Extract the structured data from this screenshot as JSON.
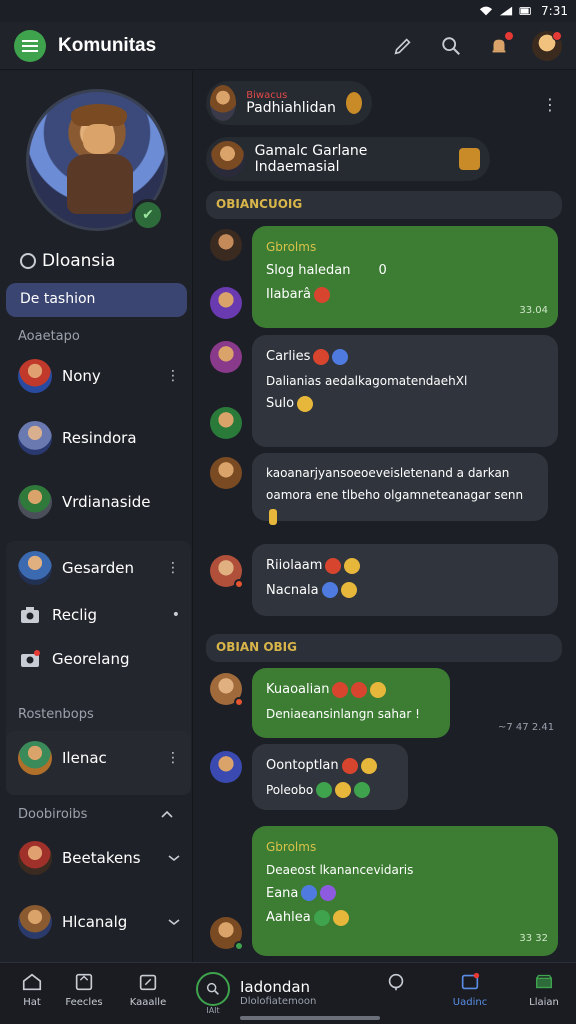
{
  "status": {
    "time": "7:31"
  },
  "topbar": {
    "title": "Komunitas",
    "icons": [
      "pen-icon",
      "search-icon",
      "bell-icon",
      "avatar"
    ]
  },
  "sidebar": {
    "profile_name": "Dloansia",
    "active_item": "De tashion",
    "section1": "Aoaetapo",
    "items1": [
      {
        "label": "Nony",
        "more": "⋮"
      },
      {
        "label": "Resindora"
      },
      {
        "label": "Vrdianaside"
      },
      {
        "label": "Gesarden",
        "more": "⋮"
      },
      {
        "label": "Reclig",
        "more": "•"
      },
      {
        "label": "Georelang"
      }
    ],
    "section2": "Rostenbops",
    "items2": [
      {
        "label": "Ilenac",
        "more": "⋮"
      }
    ],
    "section3": "Doobiroibs",
    "items3": [
      {
        "label": "Beetakens"
      },
      {
        "label": "Hlcanalg"
      }
    ]
  },
  "main": {
    "pinned1": {
      "pre": "Biwacus",
      "label": "Padhiahlidan"
    },
    "pinned2": {
      "label": "Gamalc Garlane Indaemasial"
    },
    "day1": "OBIANCUOIG",
    "day2": "OBIAN OBIG",
    "messages": [
      {
        "sender": "Gbrolms",
        "line1": "Slog haledan",
        "line1b": "0",
        "line2": "Ilabarâ",
        "time": "33.04"
      },
      {
        "line1": "Carlies",
        "line2": "Dalianias aedalkagomatendaehXl",
        "line3": "Sulo"
      },
      {
        "line1": "kaoanarjyansoeoeveisletenand a darkan",
        "line2": "oamora ene tlbeho olgamneteanagar senn"
      },
      {
        "line1": "Riiolaam",
        "line2": "Nacnala"
      },
      {
        "line1": "Kuaoalian",
        "line2": "Deniaeansinlangn sahar !"
      },
      {
        "line1": "Oontoptlan",
        "line2": "Poleobo"
      },
      {
        "sender": "Gbrolms",
        "line1": "Deaeost lkanancevidaris",
        "line2": "Eana",
        "line3": "Aahlea",
        "time": "33 32"
      }
    ],
    "float_time": "~7 47 2.41"
  },
  "bottom_nav": {
    "items": [
      {
        "label": "Hat"
      },
      {
        "label": "Feecles"
      },
      {
        "label": "Kaaalle"
      },
      {
        "label": "Uadinc"
      },
      {
        "label": "Llaian"
      }
    ],
    "search_label": "Iadondan",
    "search_sub": "Dlolofiatemoon",
    "search_small": "IAIt"
  }
}
